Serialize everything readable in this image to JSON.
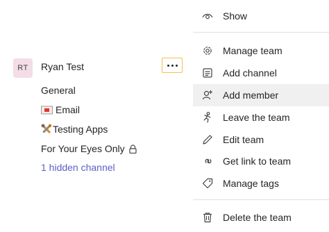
{
  "team": {
    "initials": "RT",
    "name": "Ryan Test",
    "channels": [
      {
        "label": "General"
      },
      {
        "label": "Email"
      },
      {
        "label": "Testing Apps"
      },
      {
        "label": "For Your Eyes Only"
      }
    ],
    "hidden_link": "1 hidden channel"
  },
  "menu": {
    "items": [
      {
        "label": "Show",
        "icon": "eye-icon"
      },
      {
        "label": "Manage team",
        "icon": "gear-icon"
      },
      {
        "label": "Add channel",
        "icon": "add-channel-icon"
      },
      {
        "label": "Add member",
        "icon": "add-person-icon"
      },
      {
        "label": "Leave the team",
        "icon": "leave-icon"
      },
      {
        "label": "Edit team",
        "icon": "pencil-icon"
      },
      {
        "label": "Get link to team",
        "icon": "link-icon"
      },
      {
        "label": "Manage tags",
        "icon": "tag-icon"
      },
      {
        "label": "Delete the team",
        "icon": "trash-icon"
      }
    ]
  },
  "colors": {
    "accent_link": "#5b5fc7",
    "focus_border": "#f2c14e",
    "avatar_bg": "#f3dde6",
    "hover_bg": "#f0f0f0"
  }
}
